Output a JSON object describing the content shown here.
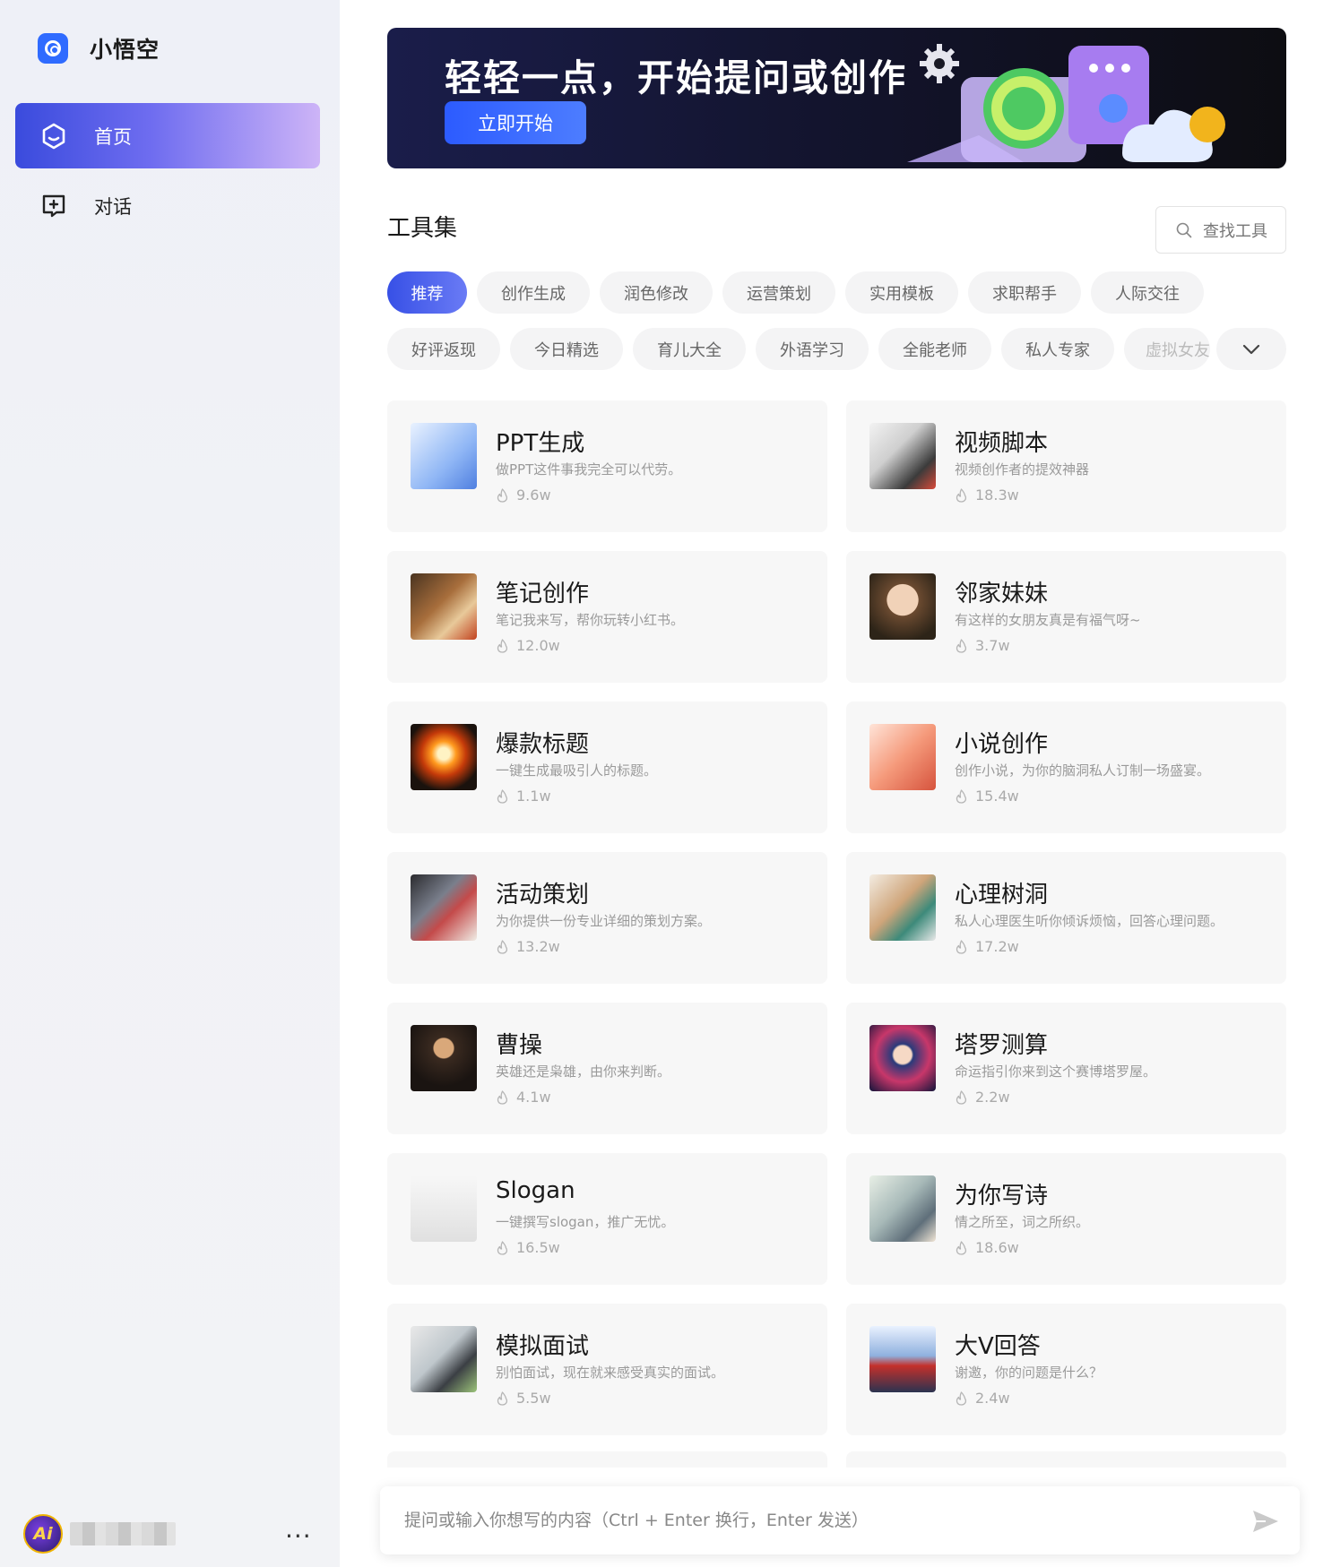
{
  "app": {
    "name": "小悟空"
  },
  "sidebar": {
    "items": [
      {
        "label": "首页",
        "icon": "home-hexagon-icon",
        "active": true
      },
      {
        "label": "对话",
        "icon": "chat-plus-icon",
        "active": false
      }
    ],
    "user": {
      "avatar_text": "Ai",
      "more_label": "···"
    }
  },
  "banner": {
    "title": "轻轻一点，开始提问或创作",
    "button_label": "立即开始"
  },
  "tools": {
    "section_title": "工具集",
    "search_placeholder": "查找工具",
    "categories_row1": [
      "推荐",
      "创作生成",
      "润色修改",
      "运营策划",
      "实用模板",
      "求职帮手",
      "人际交往"
    ],
    "categories_row2": [
      "好评返现",
      "今日精选",
      "育儿大全",
      "外语学习",
      "全能老师",
      "私人专家",
      "虚拟女友"
    ],
    "active_category": "推荐",
    "cards": [
      {
        "title": "PPT生成",
        "desc": "做PPT这件事我完全可以代劳。",
        "uses": "9.6w"
      },
      {
        "title": "视频脚本",
        "desc": "视频创作者的提效神器",
        "uses": "18.3w"
      },
      {
        "title": "笔记创作",
        "desc": "笔记我来写，帮你玩转小红书。",
        "uses": "12.0w"
      },
      {
        "title": "邻家妹妹",
        "desc": "有这样的女朋友真是有福气呀~",
        "uses": "3.7w"
      },
      {
        "title": "爆款标题",
        "desc": "一键生成最吸引人的标题。",
        "uses": "1.1w"
      },
      {
        "title": "小说创作",
        "desc": "创作小说，为你的脑洞私人订制一场盛宴。",
        "uses": "15.4w"
      },
      {
        "title": "活动策划",
        "desc": "为你提供一份专业详细的策划方案。",
        "uses": "13.2w"
      },
      {
        "title": "心理树洞",
        "desc": "私人心理医生听你倾诉烦恼，回答心理问题。",
        "uses": "17.2w"
      },
      {
        "title": "曹操",
        "desc": "英雄还是枭雄，由你来判断。",
        "uses": "4.1w"
      },
      {
        "title": "塔罗测算",
        "desc": "命运指引你来到这个赛博塔罗屋。",
        "uses": "2.2w"
      },
      {
        "title": "Slogan",
        "desc": "一键撰写slogan，推广无忧。",
        "uses": "16.5w"
      },
      {
        "title": "为你写诗",
        "desc": "情之所至，词之所织。",
        "uses": "18.6w"
      },
      {
        "title": "模拟面试",
        "desc": "别怕面试，现在就来感受真实的面试。",
        "uses": "5.5w"
      },
      {
        "title": "大V回答",
        "desc": "谢邀，你的问题是什么？",
        "uses": "2.4w"
      }
    ]
  },
  "input": {
    "placeholder": "提问或输入你想写的内容（Ctrl + Enter 换行，Enter 发送）"
  },
  "colors": {
    "accent": "#3750e6",
    "brand": "#2f6bff",
    "sidebar_bg": "#f1f2f6",
    "card_bg": "#f7f7f7"
  }
}
